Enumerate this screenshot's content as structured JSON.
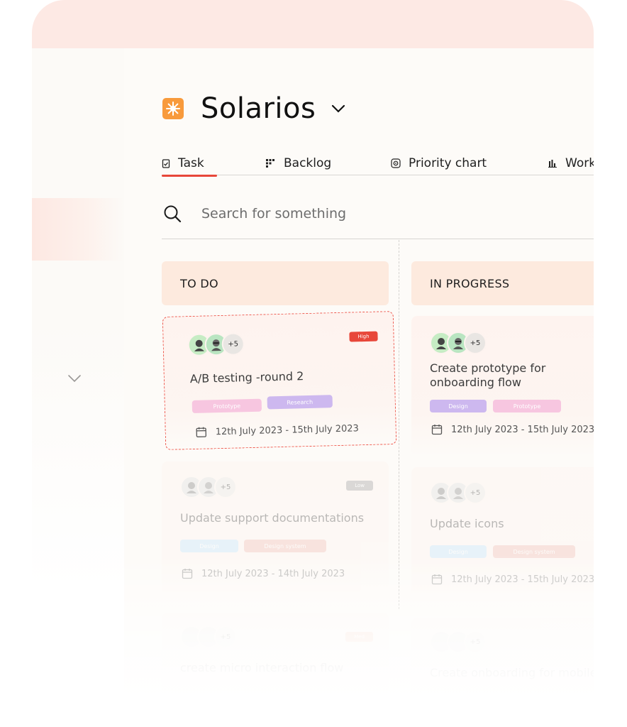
{
  "project": {
    "name": "Solarios",
    "logo_icon": "sun-icon",
    "logo_color": "#f89a3c"
  },
  "tabs": [
    {
      "label": "Task",
      "icon": "task-icon",
      "active": true
    },
    {
      "label": "Backlog",
      "icon": "backlog-icon",
      "active": false
    },
    {
      "label": "Priority chart",
      "icon": "priority-icon",
      "active": false
    },
    {
      "label": "Work",
      "icon": "bar-chart-icon",
      "active": false
    }
  ],
  "search": {
    "placeholder": "Search for something"
  },
  "columns": [
    {
      "title": "TO DO",
      "cards": [
        {
          "title": "A/B testing -round 2",
          "priority": "High",
          "priority_color": "#e8473a",
          "extra_members": "+5",
          "tags": [
            {
              "label": "Prototype",
              "color": "#f7c6e0"
            },
            {
              "label": "Research",
              "color": "#cdb8ef"
            }
          ],
          "dates": "12th July  2023 - 15th July 2023",
          "state": "dragging"
        },
        {
          "title": "Update support documentations",
          "priority": "Low",
          "priority_color": "#9a9a9a",
          "extra_members": "+5",
          "tags": [
            {
              "label": "Design",
              "color": "#bfe4fb"
            },
            {
              "label": "Design system",
              "color": "#f1b9b0"
            }
          ],
          "dates": "12th July  2023 - 14th July 2023"
        },
        {
          "title": "create micro interaction flow",
          "priority": "Med",
          "priority_color": "#f19b7a",
          "extra_members": "+5"
        }
      ]
    },
    {
      "title": "IN PROGRESS",
      "cards": [
        {
          "title": "Create prototype for onboarding flow",
          "extra_members": "+5",
          "tags": [
            {
              "label": "Design",
              "color": "#cdb8ef"
            },
            {
              "label": "Prototype",
              "color": "#f7c6e0"
            }
          ],
          "dates": "12th July  2023 - 15th July 2023"
        },
        {
          "title": "Update icons",
          "extra_members": "+5",
          "tags": [
            {
              "label": "Design",
              "color": "#bfe4fb"
            },
            {
              "label": "Design system",
              "color": "#f1b9b0"
            }
          ],
          "dates": "12th July  2023 - 15th July 2023"
        },
        {
          "title": "Create onboarding for mobile",
          "extra_members": "+5"
        }
      ]
    }
  ]
}
